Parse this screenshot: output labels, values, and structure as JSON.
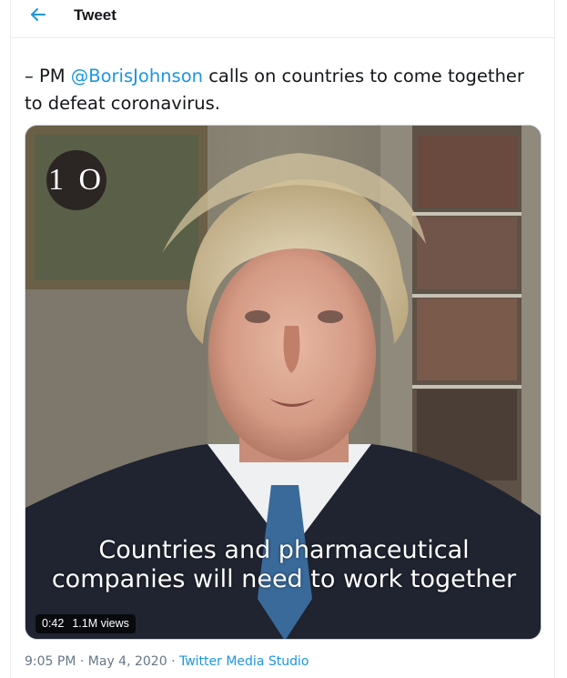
{
  "header": {
    "back_icon": "arrow-left-icon",
    "title": "Tweet"
  },
  "tweet": {
    "text_prefix": "– PM ",
    "mention": "@BorisJohnson",
    "text_suffix": " calls on countries to come together to defeat coronavirus."
  },
  "media": {
    "logo_text": "1 O",
    "caption_line1": "Countries and pharmaceutical",
    "caption_line2": "companies will need to work together",
    "duration": "0:42",
    "views": "1.1M views"
  },
  "meta": {
    "time": "9:05 PM",
    "separator1": "·",
    "date": "May 4, 2020",
    "separator2": "·",
    "source": "Twitter Media Studio"
  },
  "colors": {
    "accent": "#1b95e0",
    "border": "#e6ecf0",
    "secondary_text": "#657786"
  }
}
